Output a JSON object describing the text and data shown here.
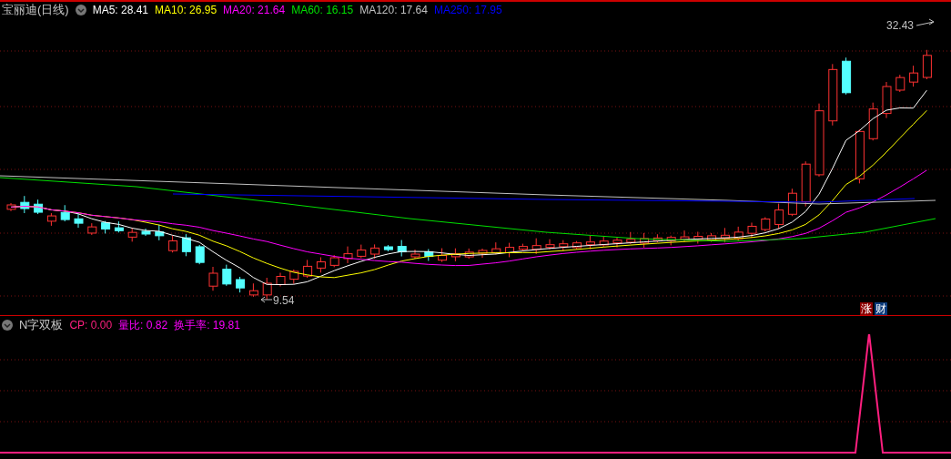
{
  "title": "宝丽迪(日线)",
  "moving_averages": [
    {
      "label": "MA5: 28.41",
      "color": "#ffffff"
    },
    {
      "label": "MA10: 26.95",
      "color": "#ffff00"
    },
    {
      "label": "MA20: 21.64",
      "color": "#ff00ff"
    },
    {
      "label": "MA60: 16.15",
      "color": "#00e000"
    },
    {
      "label": "MA120: 17.64",
      "color": "#c0c0c0"
    },
    {
      "label": "MA250: 17.95",
      "color": "#0000ff"
    }
  ],
  "high_label": "32.43",
  "low_label": "9.54",
  "badges": [
    {
      "text": "涨",
      "color": "#8b0000"
    },
    {
      "text": "财",
      "color": "#0a3a7a"
    }
  ],
  "indicator": {
    "name": "N字双板",
    "values": [
      {
        "label": "CP: 0.00",
        "color": "#ff1f7f"
      },
      {
        "label": "量比: 0.82",
        "color": "#ff00ff"
      },
      {
        "label": "换手率: 19.81",
        "color": "#ff00ff"
      }
    ]
  }
}
